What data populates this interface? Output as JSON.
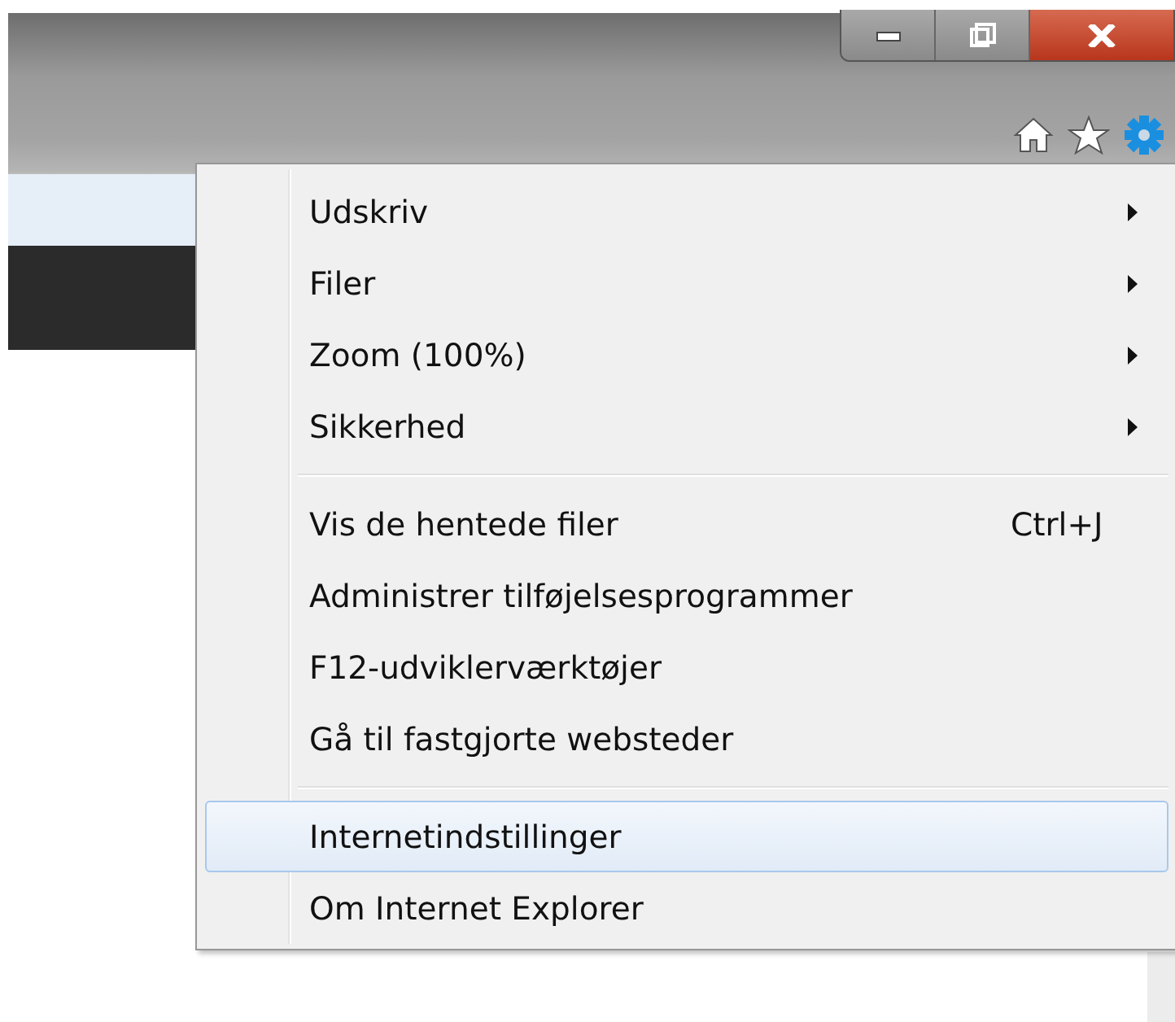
{
  "menu": {
    "groups": [
      [
        {
          "label": "Udskriv",
          "submenu": true,
          "selected": false
        },
        {
          "label": "Filer",
          "submenu": true,
          "selected": false
        },
        {
          "label": "Zoom (100%)",
          "submenu": true,
          "selected": false
        },
        {
          "label": "Sikkerhed",
          "submenu": true,
          "selected": false
        }
      ],
      [
        {
          "label": "Vis de hentede filer",
          "shortcut": "Ctrl+J",
          "submenu": false,
          "selected": false
        },
        {
          "label": "Administrer tilføjelsesprogrammer",
          "submenu": false,
          "selected": false
        },
        {
          "label": "F12-udviklerværktøjer",
          "submenu": false,
          "selected": false
        },
        {
          "label": "Gå til fastgjorte websteder",
          "submenu": false,
          "selected": false
        }
      ],
      [
        {
          "label": "Internetindstillinger",
          "submenu": false,
          "selected": true
        },
        {
          "label": "Om Internet Explorer",
          "submenu": false,
          "selected": false
        }
      ]
    ]
  }
}
